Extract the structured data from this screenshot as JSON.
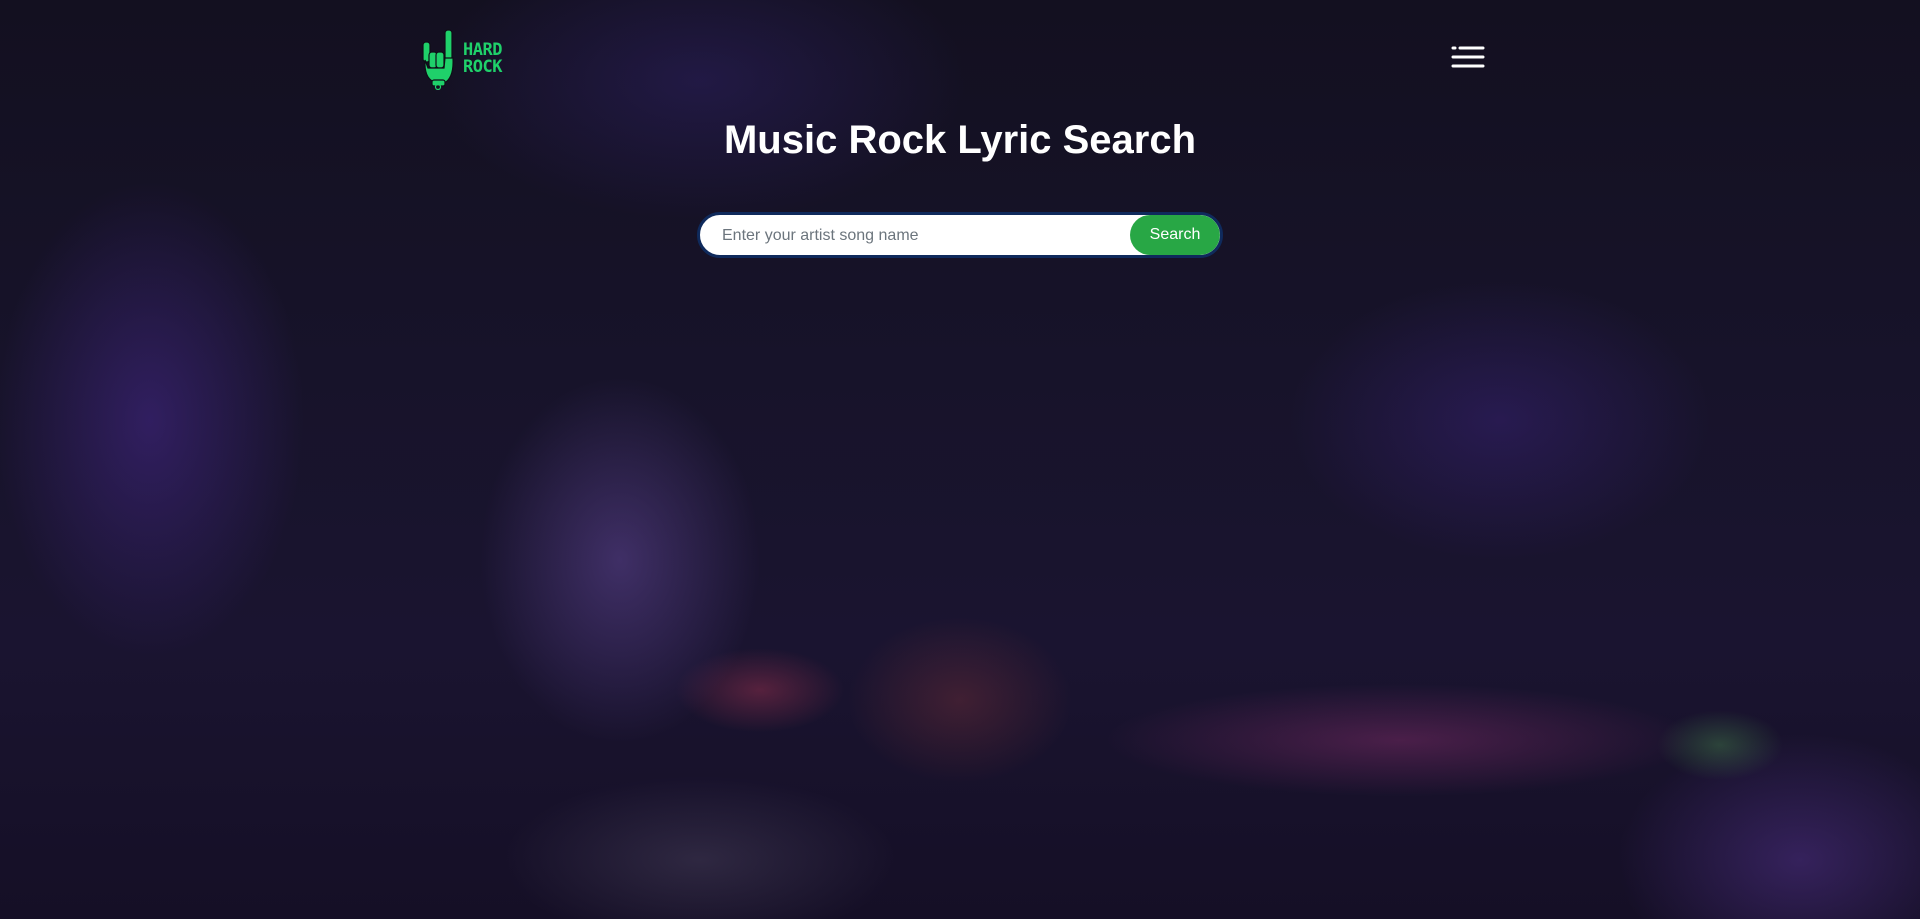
{
  "header": {
    "logo_text_line1": "HARD",
    "logo_text_line2": "ROCK",
    "menu_icon": "hamburger-menu-icon"
  },
  "main": {
    "title": "Music Rock Lyric Search",
    "search": {
      "value": "",
      "placeholder": "Enter your artist song name",
      "button_label": "Search"
    }
  },
  "colors": {
    "accent_green": "#28a745",
    "logo_green": "#1fd16a",
    "background": "#0f0e17",
    "search_border": "#0f2a5c"
  }
}
